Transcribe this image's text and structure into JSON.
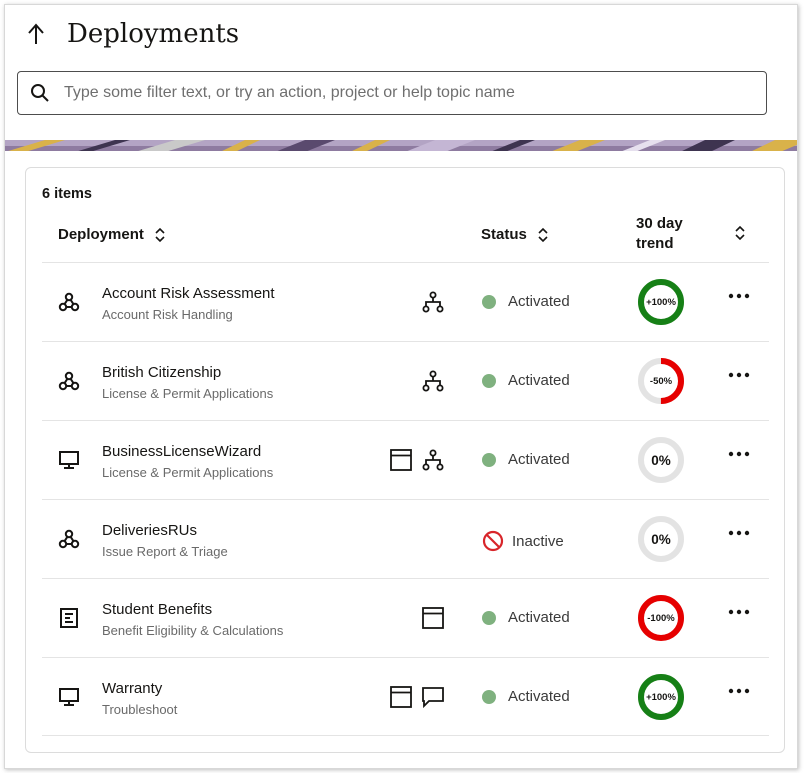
{
  "header": {
    "title": "Deployments",
    "back_icon": "arrow-up-icon"
  },
  "search": {
    "placeholder": "Type some filter text, or try an action, project or help topic name",
    "value": ""
  },
  "table": {
    "count_label": "6 items",
    "columns": {
      "deployment": "Deployment",
      "status": "Status",
      "trend_line1": "30 day",
      "trend_line2": "trend"
    },
    "rows": [
      {
        "name": "Account Risk Assessment",
        "project": "Account Risk Handling",
        "type_icon": "webhook-icon",
        "channels": [
          "hierarchy-icon"
        ],
        "status": "Activated",
        "status_state": "active",
        "trend_label": "+100%",
        "trend_value": 100
      },
      {
        "name": "British Citizenship",
        "project": "License & Permit Applications",
        "type_icon": "webhook-icon",
        "channels": [
          "hierarchy-icon"
        ],
        "status": "Activated",
        "status_state": "active",
        "trend_label": "-50%",
        "trend_value": -50
      },
      {
        "name": "BusinessLicenseWizard",
        "project": "License & Permit Applications",
        "type_icon": "monitor-icon",
        "channels": [
          "window-icon",
          "hierarchy-icon"
        ],
        "status": "Activated",
        "status_state": "active",
        "trend_label": "0%",
        "trend_value": 0
      },
      {
        "name": "DeliveriesRUs",
        "project": "Issue Report & Triage",
        "type_icon": "webhook-icon",
        "channels": [],
        "status": "Inactive",
        "status_state": "inactive",
        "trend_label": "0%",
        "trend_value": 0
      },
      {
        "name": "Student Benefits",
        "project": "Benefit Eligibility & Calculations",
        "type_icon": "form-icon",
        "channels": [
          "window-icon"
        ],
        "status": "Activated",
        "status_state": "active",
        "trend_label": "-100%",
        "trend_value": -100
      },
      {
        "name": "Warranty",
        "project": "Troubleshoot",
        "type_icon": "monitor-icon",
        "channels": [
          "window-icon",
          "chat-bubble-icon"
        ],
        "status": "Activated",
        "status_state": "active",
        "trend_label": "+100%",
        "trend_value": 100
      }
    ]
  },
  "colors": {
    "positive": "#168016",
    "negative": "#e60000",
    "neutral_track": "#e3e3e3",
    "active_dot": "#7fb17f",
    "inactive": "#d8252a"
  }
}
